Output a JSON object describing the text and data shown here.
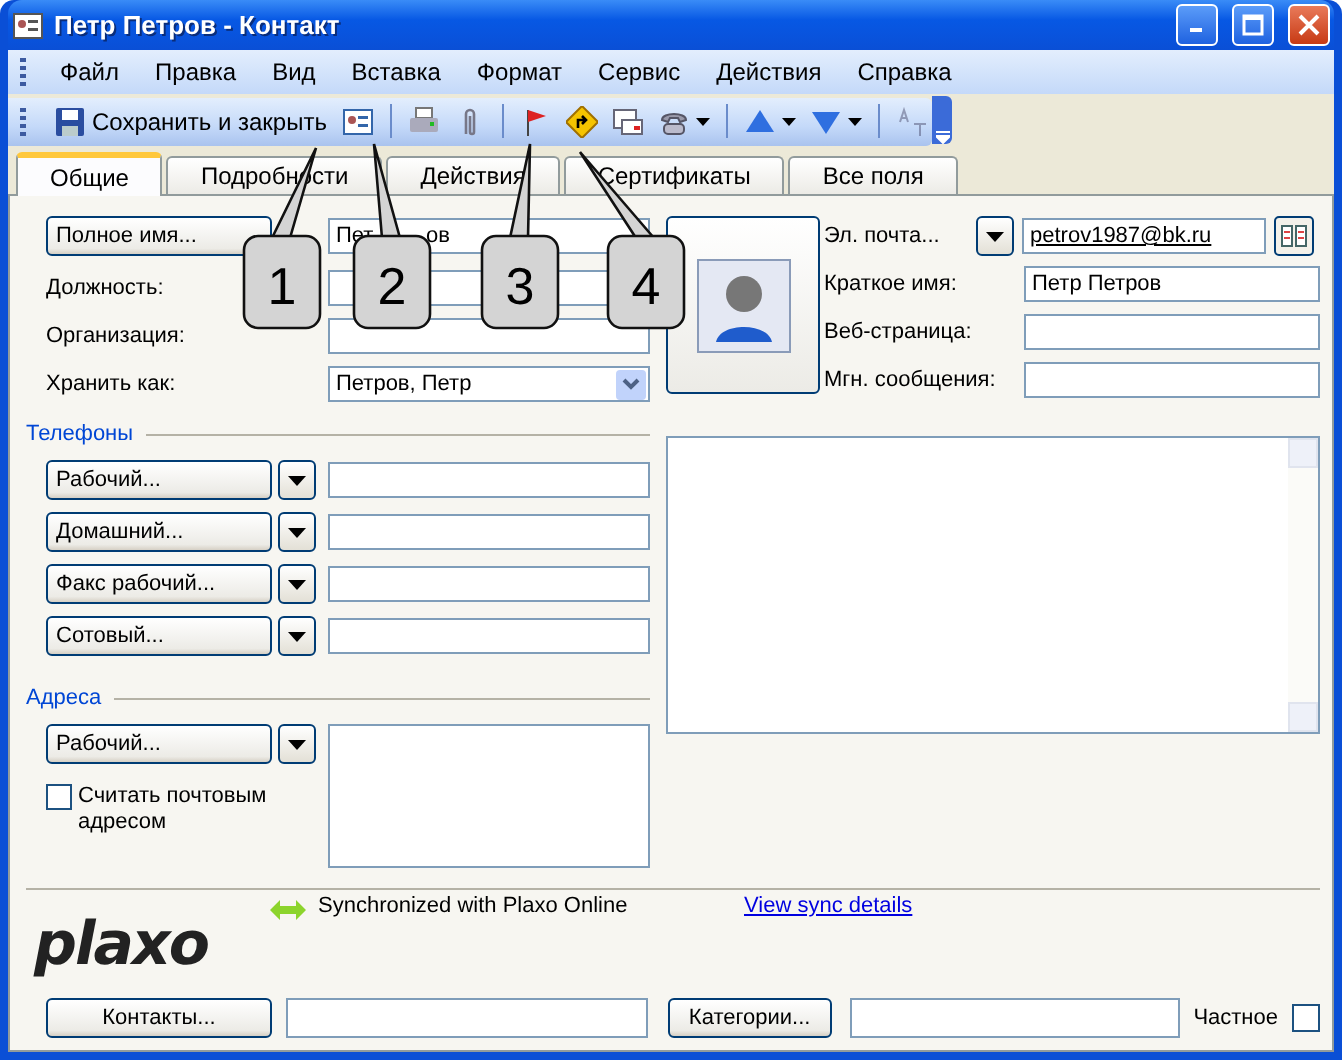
{
  "window": {
    "title": "Петр Петров - Контакт"
  },
  "menu": [
    "Файл",
    "Правка",
    "Вид",
    "Вставка",
    "Формат",
    "Сервис",
    "Действия",
    "Справка"
  ],
  "toolbar": [
    {
      "kind": "labeled",
      "label": "Сохранить и закрыть"
    },
    {
      "kind": "icon"
    },
    {
      "kind": "separator"
    },
    {
      "kind": "icon"
    },
    {
      "kind": "icon"
    },
    {
      "kind": "separator"
    },
    {
      "kind": "icon"
    },
    {
      "kind": "icon"
    },
    {
      "kind": "icon"
    },
    {
      "kind": "dropdown"
    },
    {
      "kind": "separator"
    },
    {
      "kind": "dropdown"
    },
    {
      "kind": "dropdown"
    },
    {
      "kind": "separator"
    },
    {
      "kind": "icon",
      "disabled": true
    }
  ],
  "tabs": [
    {
      "label": "Общие",
      "selected": true
    },
    {
      "label": "Подробности",
      "selected": false
    },
    {
      "label": "Действия",
      "selected": false
    },
    {
      "label": "Сертификаты",
      "selected": false
    },
    {
      "label": "Все поля",
      "selected": false
    }
  ],
  "name_fields": [
    {
      "kind": "button",
      "label": "Полное имя...",
      "value_parts": [
        "Пет",
        "ов"
      ]
    },
    {
      "kind": "text",
      "label": "Должность:"
    },
    {
      "kind": "text",
      "label": "Организация:"
    },
    {
      "kind": "select",
      "label": "Хранить как:",
      "value": "Петров, Петр"
    }
  ],
  "phones": {
    "heading": "Телефоны",
    "rows": [
      {
        "label": "Рабочий..."
      },
      {
        "label": "Домашний..."
      },
      {
        "label": "Факс рабочий..."
      },
      {
        "label": "Сотовый..."
      }
    ]
  },
  "addresses": {
    "heading": "Адреса",
    "type_label": "Рабочий...",
    "mailing_checkbox": {
      "label": "Считать почтовым адресом",
      "checked": false
    }
  },
  "email": {
    "label": "Эл. почта...",
    "value": "petrov1987@bk.ru"
  },
  "contact_fields": [
    {
      "label": "Краткое имя:",
      "value": "Петр Петров"
    },
    {
      "label": "Веб-страница:"
    },
    {
      "label": "Мгн. сообщения:"
    }
  ],
  "plaxo": {
    "logo": "plaxo",
    "status": "Synchronized with Plaxo Online",
    "link": "View sync details"
  },
  "footer": {
    "contacts_button": "Контакты...",
    "categories_button": "Категории...",
    "private": {
      "label": "Частное",
      "checked": false
    }
  },
  "callouts": [
    {
      "label": "1"
    },
    {
      "label": "2"
    },
    {
      "label": "3"
    },
    {
      "label": "4"
    }
  ]
}
